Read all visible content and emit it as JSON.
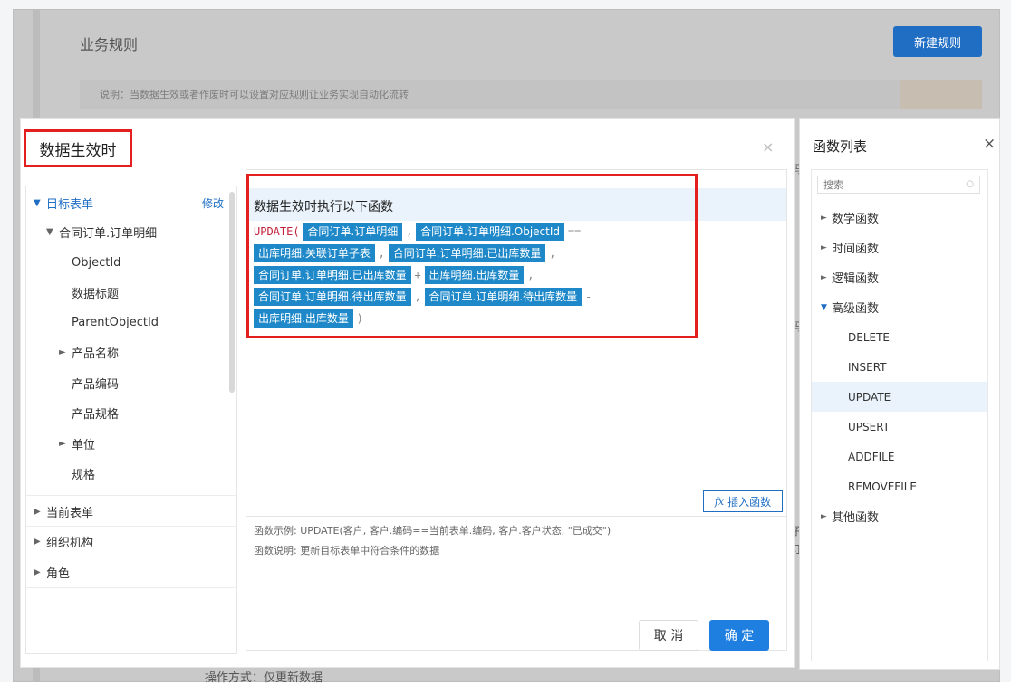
{
  "background": {
    "title": "业务规则",
    "new_rule_button": "新建规则",
    "description": "说明：当数据生效或者作废时可以设置对应规则让业务实现自动化流转",
    "bottom_text": "操作方式：仅更新数据",
    "edge_chars": [
      "码",
      "码",
      "子",
      "订"
    ]
  },
  "dialog": {
    "title": "数据生效时",
    "close_icon": "×",
    "cancel_label": "取 消",
    "ok_label": "确 定"
  },
  "tree": {
    "target_form": "目标表单",
    "edit_label": "修改",
    "sub_form": "合同订单.订单明细",
    "fields": [
      "ObjectId",
      "数据标题",
      "ParentObjectId",
      "产品名称",
      "产品编码",
      "产品规格",
      "单位",
      "规格"
    ],
    "sections": [
      "当前表单",
      "组织机构",
      "角色"
    ]
  },
  "editor": {
    "heading": "数据生效时执行以下函数",
    "func": "UPDATE(",
    "tokens": [
      "合同订单.订单明细",
      "合同订单.订单明细.ObjectId",
      "出库明细.关联订单子表",
      "合同订单.订单明细.已出库数量",
      "合同订单.订单明细.已出库数量",
      "出库明细.出库数量",
      "合同订单.订单明细.待出库数量",
      "合同订单.订单明细.待出库数量",
      "出库明细.出库数量"
    ],
    "ops": {
      "comma": ",",
      "eq": "==",
      "plus": "+",
      "minus": "-",
      "close": ")"
    },
    "insert_button": "插入函数",
    "insert_icon": "fx",
    "example": "函数示例: UPDATE(客户, 客户.编码==当前表单.编码, 客户.客户状态, \"已成交\")",
    "description": "函数说明: 更新目标表单中符合条件的数据"
  },
  "function_list": {
    "title": "函数列表",
    "close_icon": "×",
    "search_placeholder": "搜索",
    "categories": [
      "数学函数",
      "时间函数",
      "逻辑函数",
      "高级函数",
      "其他函数"
    ],
    "advanced_functions": [
      "DELETE",
      "INSERT",
      "UPDATE",
      "UPSERT",
      "ADDFILE",
      "REMOVEFILE"
    ],
    "selected": "UPDATE"
  },
  "colors": {
    "accent": "#1f6ec4",
    "token_bg": "#1e88c9",
    "highlight_border": "#e41f1f",
    "keyword": "#c4203a"
  }
}
